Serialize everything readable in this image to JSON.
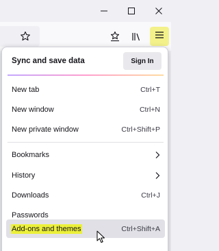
{
  "window_controls": {
    "minimize_icon": "minimize-icon",
    "maximize_icon": "maximize-icon",
    "close_icon": "close-icon"
  },
  "toolbar": {
    "bookmark_icon": "star-icon",
    "pocket_icon": "save-to-pocket-icon",
    "library_icon": "library-icon",
    "menu_icon": "hamburger-icon",
    "menu_button_highlight": "#f3f18a"
  },
  "menu": {
    "sync": {
      "label": "Sync and save data",
      "sign_in_label": "Sign In"
    },
    "groups": [
      [
        {
          "label": "New tab",
          "shortcut": "Ctrl+T"
        },
        {
          "label": "New window",
          "shortcut": "Ctrl+N"
        },
        {
          "label": "New private window",
          "shortcut": "Ctrl+Shift+P"
        }
      ],
      [
        {
          "label": "Bookmarks",
          "submenu": true
        },
        {
          "label": "History",
          "submenu": true
        },
        {
          "label": "Downloads",
          "shortcut": "Ctrl+J"
        },
        {
          "label": "Passwords"
        },
        {
          "label": "Add-ons and themes",
          "shortcut": "Ctrl+Shift+A",
          "highlighted": true
        }
      ]
    ],
    "highlight_color": "#ecf03a"
  }
}
